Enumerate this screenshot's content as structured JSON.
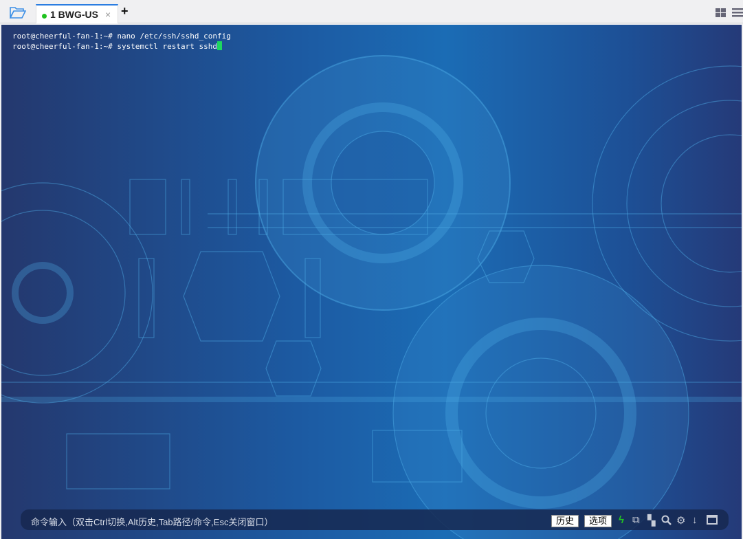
{
  "tabs": [
    {
      "label": "1 BWG-US",
      "status_color": "#1ec21e"
    }
  ],
  "icons": [
    "folder-open-icon",
    "close-icon",
    "plus-icon",
    "grid-layout-icon",
    "menu-icon",
    "lightning-icon",
    "copy-icon",
    "paste-icon",
    "search-icon",
    "gear-icon",
    "download-icon",
    "window-icon"
  ],
  "terminal": {
    "lines": [
      "root@cheerful-fan-1:~# nano /etc/ssh/sshd_config",
      "root@cheerful-fan-1:~# systemctl restart sshd"
    ]
  },
  "command_bar": {
    "placeholder": "命令输入（双击Ctrl切换,Alt历史,Tab路径/命令,Esc关闭窗口）",
    "history_label": "历史",
    "options_label": "选项"
  }
}
